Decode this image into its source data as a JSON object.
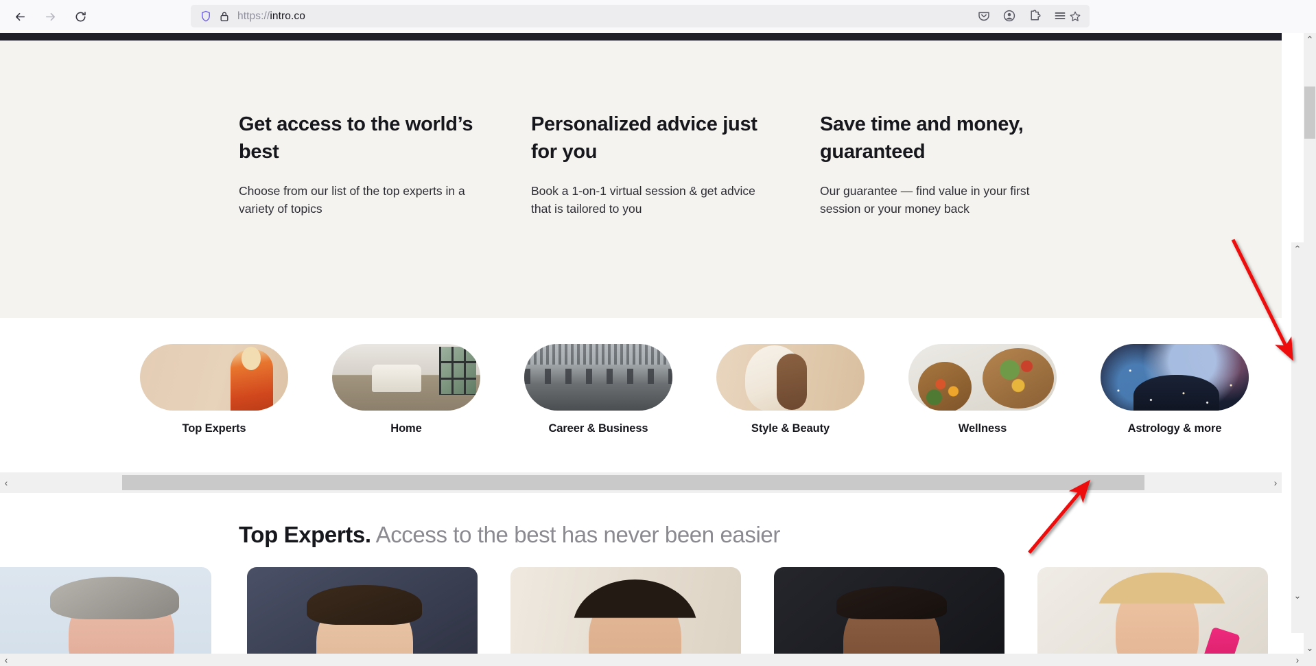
{
  "browser": {
    "back_label": "Back",
    "forward_label": "Forward",
    "reload_label": "Reload",
    "url_scheme": "https://",
    "url_host": "intro.co",
    "url_full": "https://intro.co",
    "icons": {
      "back": "arrow-left-icon",
      "forward": "arrow-right-icon",
      "reload": "reload-icon",
      "shield": "shield-icon",
      "lock": "lock-icon",
      "bookmark": "star-icon",
      "pocket": "pocket-icon",
      "account": "account-icon",
      "extensions": "extensions-icon",
      "menu": "hamburger-menu-icon"
    }
  },
  "value_props": [
    {
      "title": "Get access to the world’s best",
      "desc": "Choose from our list of the top experts in a variety of topics"
    },
    {
      "title": "Personalized advice just for you",
      "desc": "Book a 1-on-1 virtual session & get advice that is tailored to you"
    },
    {
      "title": "Save time and money, guaranteed",
      "desc": "Our guarantee — find value in your first session or your money back"
    }
  ],
  "categories": [
    {
      "label": "Top Experts",
      "art": "art-topexperts"
    },
    {
      "label": "Home",
      "art": "art-home"
    },
    {
      "label": "Career & Business",
      "art": "art-career"
    },
    {
      "label": "Style & Beauty",
      "art": "art-style"
    },
    {
      "label": "Wellness",
      "art": "art-wellness"
    },
    {
      "label": "Astrology & more",
      "art": "art-astro"
    }
  ],
  "experts_section": {
    "heading_strong": "Top Experts.",
    "heading_muted": "Access to the best has never been easier",
    "cards": [
      {
        "alt": "expert-portrait-1"
      },
      {
        "alt": "expert-portrait-2"
      },
      {
        "alt": "expert-portrait-3"
      },
      {
        "alt": "expert-portrait-4"
      },
      {
        "alt": "expert-portrait-5"
      }
    ]
  },
  "scrollbars": {
    "up_glyph": "⌃",
    "down_glyph": "⌄",
    "left_glyph": "‹",
    "right_glyph": "›"
  },
  "annotations": {
    "accent_color": "#ee1111",
    "arrow_1_label": "arrow-pointing-to-vertical-scrollbar",
    "arrow_2_label": "arrow-pointing-to-horizontal-scrollbar"
  },
  "colors": {
    "cream": "#f5f3ef",
    "dark_bar": "#1e1e28",
    "text_dark": "#16161d",
    "text_muted": "#8a8a90",
    "chrome_bg": "#f9f9fb",
    "urlbar_bg": "#ededf0",
    "scrollbar_track": "#f0f0f0",
    "scrollbar_thumb": "#c9c9c9"
  }
}
